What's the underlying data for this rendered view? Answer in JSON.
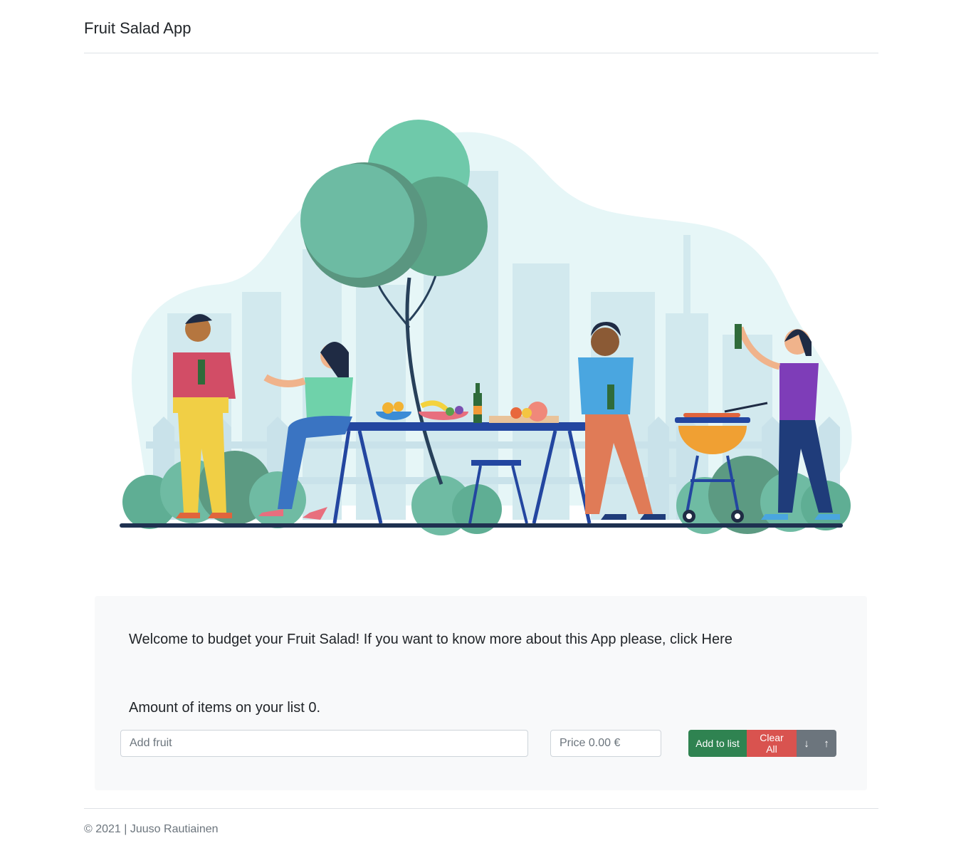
{
  "header": {
    "title": "Fruit Salad App"
  },
  "card": {
    "welcome_text": "Welcome to budget your Fruit Salad! If you want to know more about this App please, click ",
    "here_link": "Here",
    "amount_text": "Amount of items on your list 0.",
    "fruit_placeholder": "Add fruit",
    "price_placeholder": "Price 0.00 €",
    "add_label": "Add to list",
    "clear_label": "Clear All",
    "sort_down_label": "↓",
    "sort_up_label": "↑"
  },
  "footer": {
    "text": "© 2021 | Juuso Rautiainen"
  },
  "colors": {
    "add_button": "#2f8351",
    "clear_button": "#d9534f",
    "sort_button": "#6c757d"
  },
  "icons": [
    "arrow-down-icon",
    "arrow-up-icon"
  ]
}
